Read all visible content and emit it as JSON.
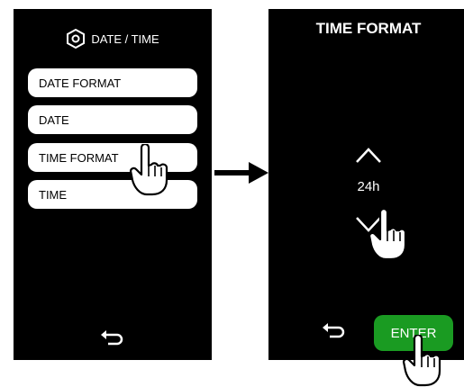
{
  "left_screen": {
    "header": {
      "icon": "settings-hex-icon",
      "title": "DATE / TIME"
    },
    "menu_items": [
      {
        "label": "DATE FORMAT"
      },
      {
        "label": "DATE"
      },
      {
        "label": "TIME FORMAT"
      },
      {
        "label": "TIME"
      }
    ],
    "back_icon": "back-arrow-icon"
  },
  "right_screen": {
    "title": "TIME FORMAT",
    "value": "24h",
    "up_icon": "chevron-up-icon",
    "down_icon": "chevron-down-icon",
    "back_icon": "back-arrow-icon",
    "enter_label": "ENTER"
  },
  "colors": {
    "screen_bg": "#000000",
    "button_bg": "#ffffff",
    "enter_bg": "#1a9b22",
    "text_light": "#ffffff"
  }
}
